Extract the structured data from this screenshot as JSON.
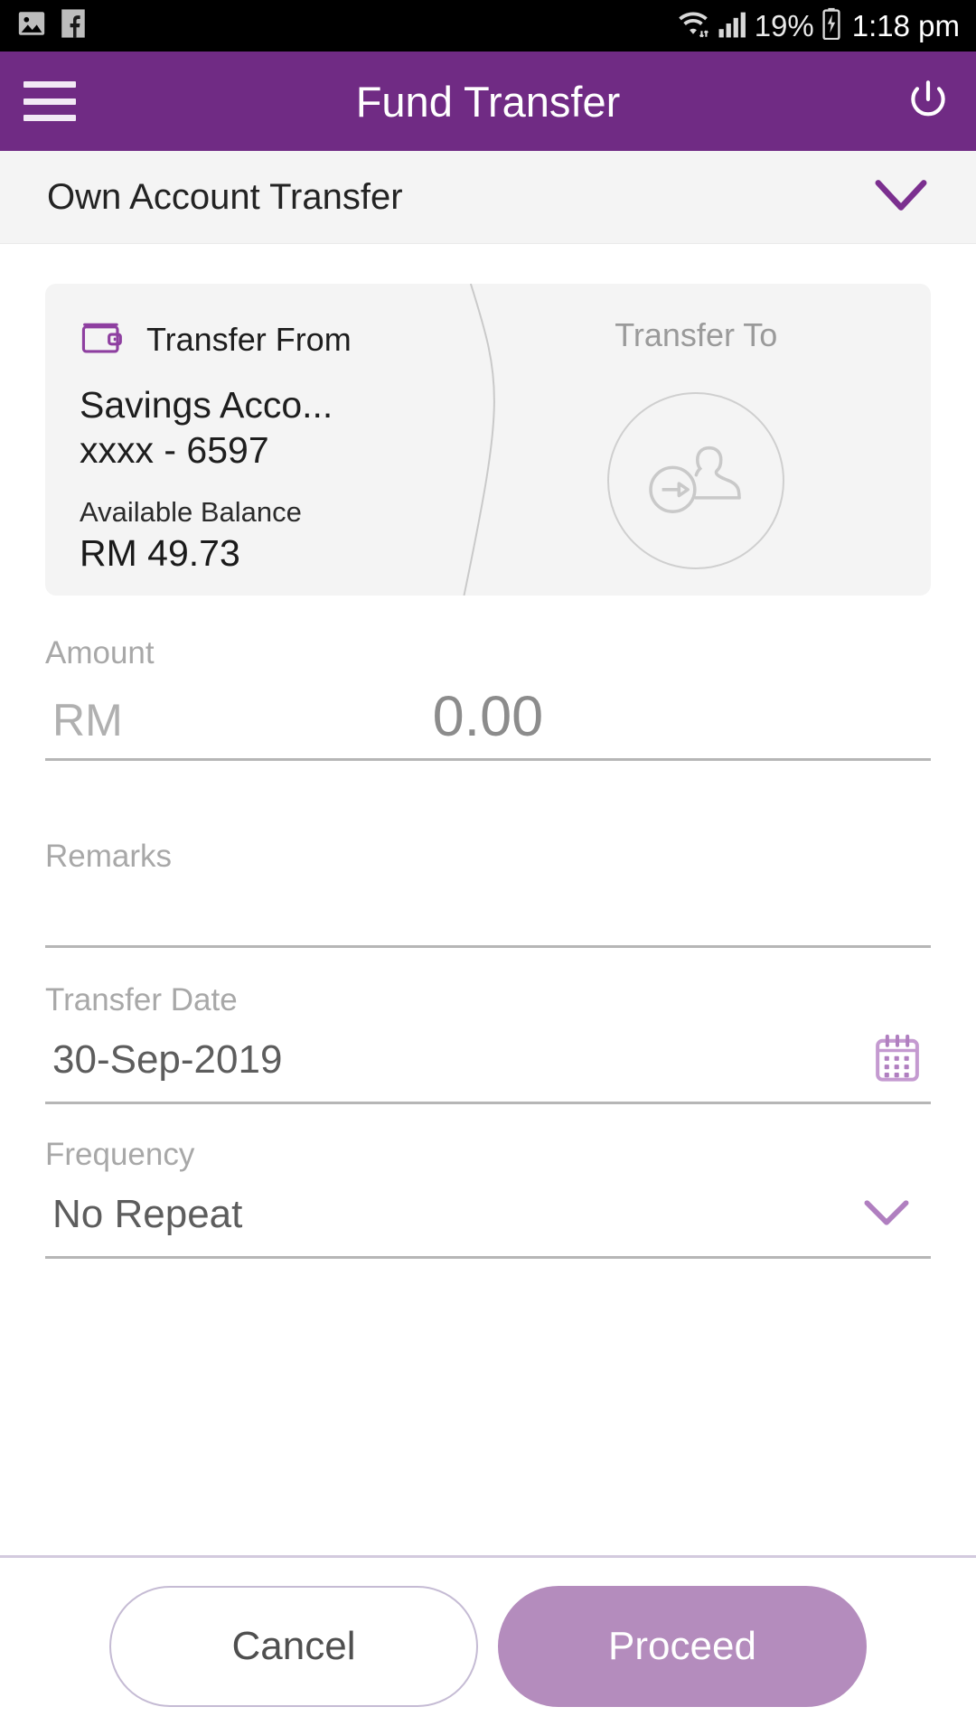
{
  "statusbar": {
    "left_icons": [
      "image-icon",
      "facebook-icon"
    ],
    "wifi_icon": "wifi-icon",
    "signal_icon": "signal-bars-icon",
    "battery_percent": "19%",
    "battery_icon": "battery-charging-icon",
    "time": "1:18 pm"
  },
  "appbar": {
    "menu_icon": "hamburger-menu-icon",
    "title": "Fund Transfer",
    "power_icon": "power-logout-icon"
  },
  "transfer_type": {
    "selected": "Own Account Transfer",
    "chevron_icon": "chevron-down-icon"
  },
  "account_card": {
    "from": {
      "wallet_icon": "wallet-icon",
      "heading": "Transfer From",
      "account_name": "Savings Acco...",
      "account_number": "xxxx - 6597",
      "balance_label": "Available Balance",
      "balance_value": "RM  49.73"
    },
    "to": {
      "heading": "Transfer To",
      "avatar_icon": "transfer-to-payee-icon"
    }
  },
  "form": {
    "amount": {
      "label": "Amount",
      "currency": "RM",
      "value": "0.00"
    },
    "remarks": {
      "label": "Remarks",
      "value": "",
      "placeholder": ""
    },
    "transfer_date": {
      "label": "Transfer Date",
      "value": "30-Sep-2019",
      "calendar_icon": "calendar-icon"
    },
    "frequency": {
      "label": "Frequency",
      "value": "No Repeat",
      "chevron_icon": "chevron-down-icon"
    }
  },
  "footer": {
    "cancel_label": "Cancel",
    "proceed_label": "Proceed"
  },
  "colors": {
    "brand_purple": "#702b84",
    "accent_purple": "#b48cbd",
    "card_bg": "#f4f4f4",
    "status_bar": "#000000"
  }
}
